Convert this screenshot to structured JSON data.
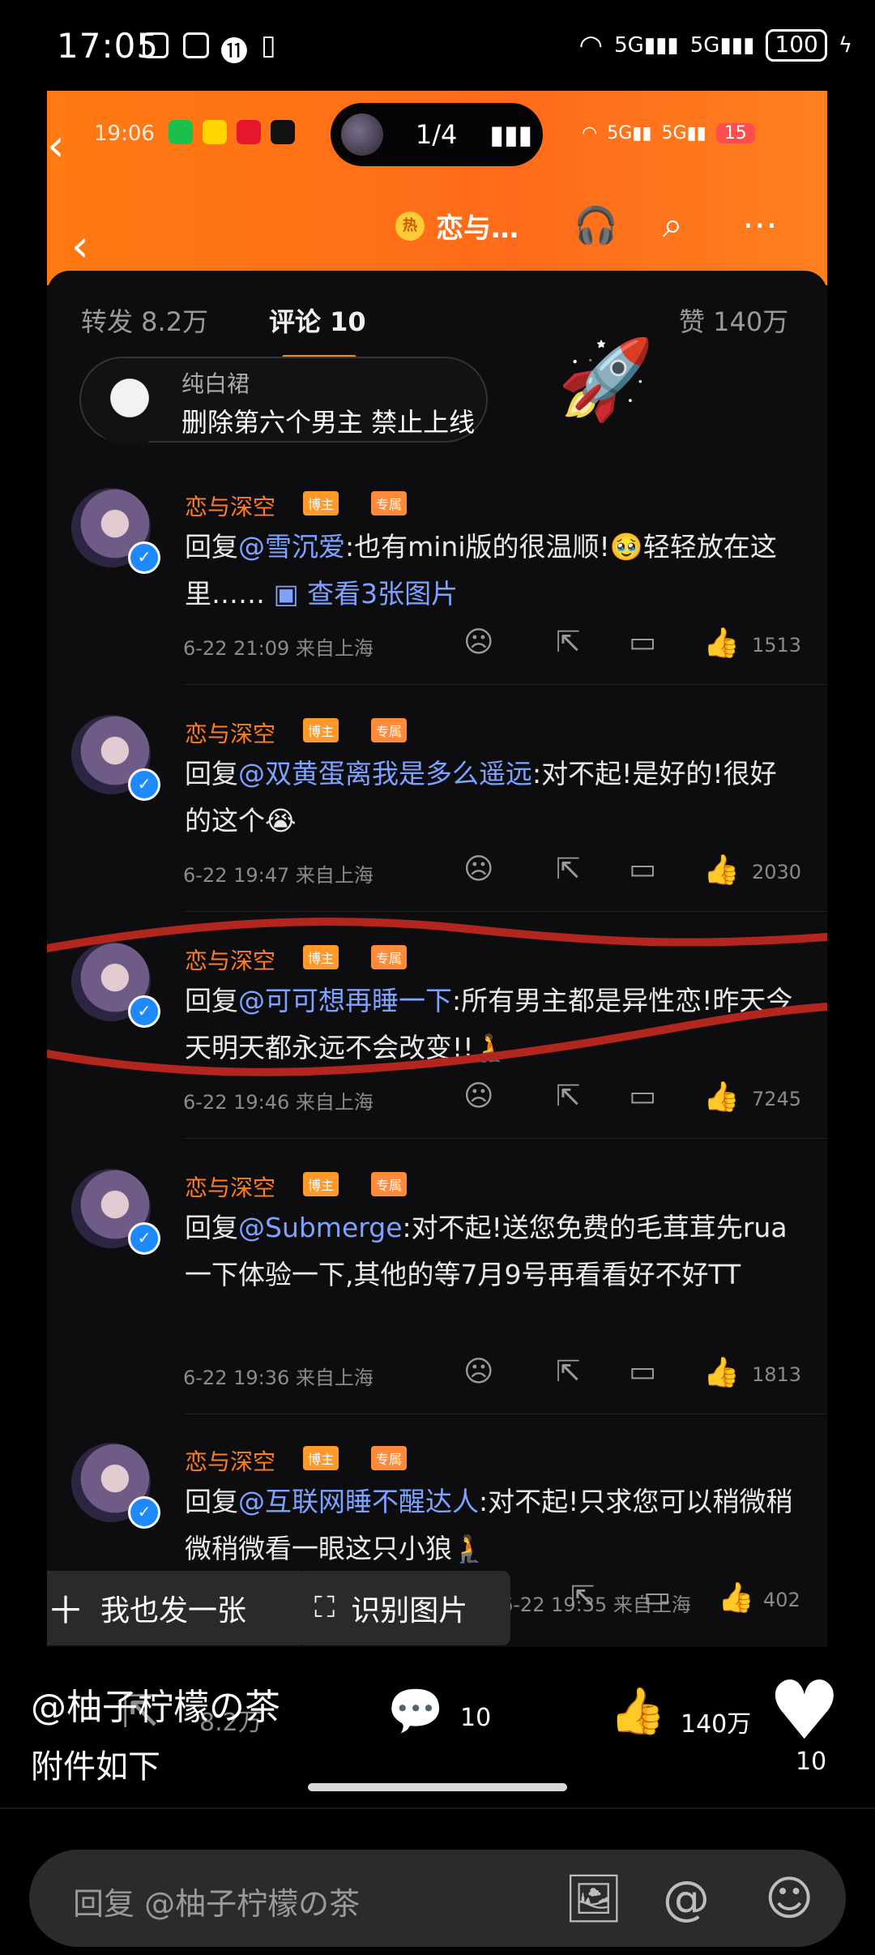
{
  "status_bar": {
    "time": "17:05",
    "network": "5G",
    "network2": "5G",
    "battery": "100"
  },
  "inner_status": {
    "time": "19:06",
    "pager": "1/4",
    "battery": "15"
  },
  "inner_header": {
    "hot": "热",
    "title": "恋与…",
    "listen": "听"
  },
  "tabs": {
    "repost": "转发 8.2万",
    "comments": "评论 10",
    "likes": "赞 140万"
  },
  "notice": {
    "nickname": "纯白裙",
    "message": "删除第六个男主 禁止上线"
  },
  "comments": [
    {
      "name": "恋与深空",
      "badge1": "博主",
      "badge2": "专属",
      "prefix": "回复",
      "mention": "@雪沉爱",
      "body": ":也有mini版的很温顺!🥹轻轻放在这里……",
      "link": "查看3张图片",
      "meta": "6-22 21:09 来自上海",
      "likes": "1513"
    },
    {
      "name": "恋与深空",
      "badge1": "博主",
      "badge2": "专属",
      "prefix": "回复",
      "mention": "@双黄蛋离我是多么遥远",
      "body": ":对不起!是好的!很好的这个😭",
      "link": "",
      "meta": "6-22 19:47 来自上海",
      "likes": "2030"
    },
    {
      "name": "恋与深空",
      "badge1": "博主",
      "badge2": "专属",
      "prefix": "回复",
      "mention": "@可可想再睡一下",
      "body": ":所有男主都是异性恋!昨天今天明天都永远不会改变!!🧎",
      "link": "",
      "meta": "6-22 19:46 来自上海",
      "likes": "7245"
    },
    {
      "name": "恋与深空",
      "badge1": "博主",
      "badge2": "专属",
      "prefix": "回复",
      "mention": "@Submerge",
      "body": ":对不起!送您免费的毛茸茸先rua一下体验一下,其他的等7月9号再看看好不好TT",
      "link": "",
      "meta": "6-22 19:36 来自上海",
      "likes": "1813"
    },
    {
      "name": "恋与深空",
      "badge1": "博主",
      "badge2": "专属",
      "prefix": "回复",
      "mention": "@互联网睡不醒达人",
      "body": ":对不起!只求您可以稍微稍微稍微看一眼这只小狼🧎",
      "link": "",
      "meta": "6-22 19:35 来自上海",
      "likes": "402"
    }
  ],
  "float_buttons": {
    "post": "我也发一张",
    "identify": "识别图片"
  },
  "overlay": {
    "author": "@柚子柠檬の茶",
    "caption": "附件如下",
    "repost_count": "8.2万",
    "comment_count": "10",
    "like_count": "140万",
    "heart_count": "10"
  },
  "reply_input": {
    "placeholder": "回复 @柚子柠檬の茶"
  },
  "colors": {
    "accent": "#ff7a12",
    "mention": "#7da2ff",
    "name": "#ff7d1e"
  }
}
